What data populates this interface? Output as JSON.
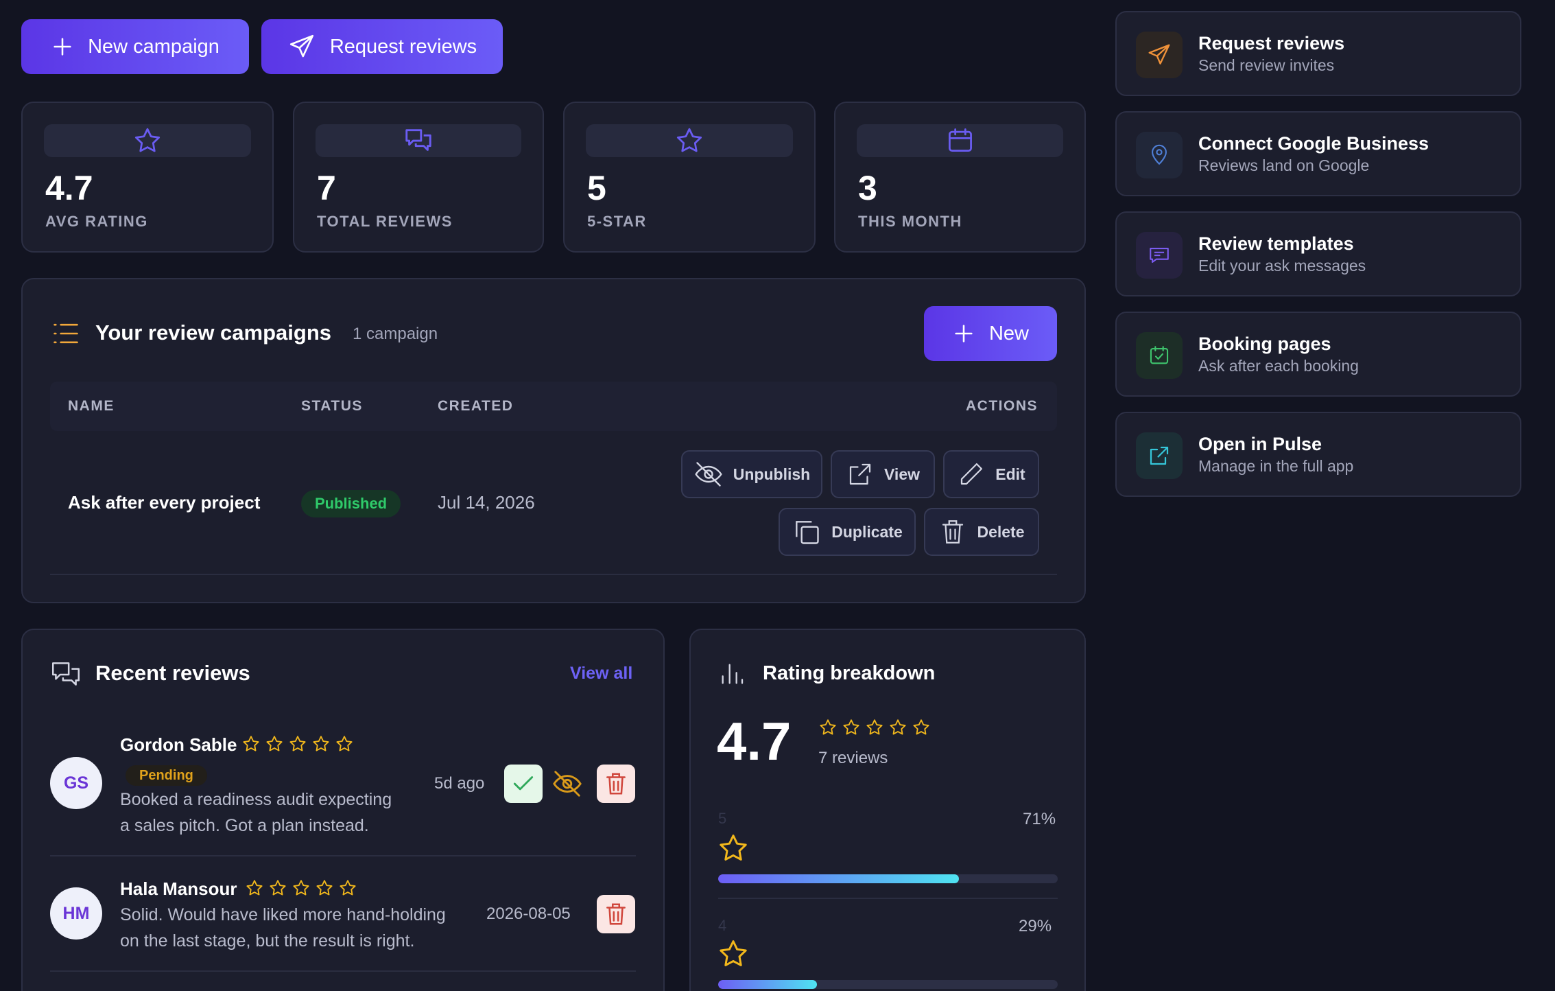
{
  "toolbar": {
    "new_campaign": "New campaign",
    "request_reviews": "Request reviews"
  },
  "stats": [
    {
      "value": "4.7",
      "label": "AVG RATING",
      "icon": "star-icon"
    },
    {
      "value": "7",
      "label": "TOTAL REVIEWS",
      "icon": "chat-bubbles-icon"
    },
    {
      "value": "5",
      "label": "5-STAR",
      "icon": "star-icon"
    },
    {
      "value": "3",
      "label": "THIS MONTH",
      "icon": "calendar-icon"
    }
  ],
  "campaigns": {
    "title": "Your review campaigns",
    "count": "1 campaign",
    "new_label": "New",
    "columns": {
      "name": "NAME",
      "status": "STATUS",
      "created": "CREATED",
      "actions": "ACTIONS"
    },
    "rows": [
      {
        "name": "Ask after every project",
        "status": "Published",
        "created": "Jul 14, 2026",
        "actions": {
          "unpublish": "Unpublish",
          "view": "View",
          "edit": "Edit",
          "duplicate": "Duplicate",
          "delete": "Delete"
        }
      }
    ]
  },
  "recent_reviews": {
    "title": "Recent reviews",
    "view_all": "View all",
    "items": [
      {
        "initials": "GS",
        "name": "Gordon Sable",
        "rating": 5,
        "badge": "Pending",
        "text_line1": "Booked a readiness audit expecting",
        "text_line2": "a sales pitch. Got a plan instead.",
        "time": "5d ago"
      },
      {
        "initials": "HM",
        "name": "Hala Mansour",
        "rating": 5,
        "text_line1": "Solid. Would have liked more hand-holding",
        "text_line2": "on the last stage, but the result is right.",
        "time": "2026-08-05"
      }
    ]
  },
  "rating_breakdown": {
    "title": "Rating breakdown",
    "average": "4.7",
    "reviews": "7 reviews",
    "rows": [
      {
        "stars": "5",
        "percent_label": "71%",
        "fraction": 0.71
      },
      {
        "stars": "4",
        "percent_label": "29%",
        "fraction": 0.29
      }
    ]
  },
  "sidebar": {
    "items": [
      {
        "title": "Request reviews",
        "subtitle": "Send review invites",
        "icon": "send-icon",
        "color": "#f0923a"
      },
      {
        "title": "Connect Google Business",
        "subtitle": "Reviews land on Google",
        "icon": "map-pin-icon",
        "color": "#4f7fd6"
      },
      {
        "title": "Review templates",
        "subtitle": "Edit your ask messages",
        "icon": "message-icon",
        "color": "#7b5cf0"
      },
      {
        "title": "Booking pages",
        "subtitle": "Ask after each booking",
        "icon": "calendar-check-icon",
        "color": "#3ec46d"
      },
      {
        "title": "Open in Pulse",
        "subtitle": "Manage in the full app",
        "icon": "external-link-icon",
        "color": "#35c6d9"
      }
    ]
  },
  "colors": {
    "accent": "#5b36e6",
    "star": "#f2b81c",
    "published": "#2fca6a",
    "pending": "#e0a21c",
    "danger": "#d0463c"
  }
}
